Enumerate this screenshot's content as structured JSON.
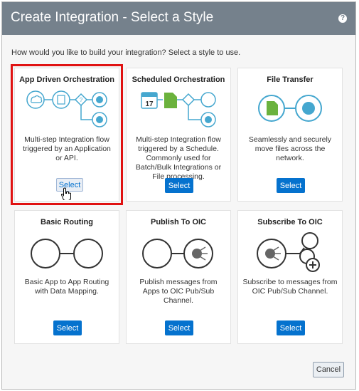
{
  "dialog": {
    "title": "Create Integration - Select a Style",
    "help_label": "?",
    "prompt": "How would you like to build your integration? Select a style to use."
  },
  "cards": [
    {
      "name": "App Driven Orchestration",
      "desc": "Multi-step Integration flow triggered by an Application or API.",
      "button": "Select",
      "selected": true
    },
    {
      "name": "Scheduled Orchestration",
      "desc": "Multi-step Integration flow triggered by a Schedule. Commonly used for Batch/Bulk Integrations or File processing.",
      "button": "Select",
      "calendar_day": "17"
    },
    {
      "name": "File Transfer",
      "desc": "Seamlessly and securely move files across the network.",
      "button": "Select"
    },
    {
      "name": "Basic Routing",
      "desc": "Basic App to App Routing with Data Mapping.",
      "button": "Select"
    },
    {
      "name": "Publish To OIC",
      "desc": "Publish messages from Apps to OIC Pub/Sub Channel.",
      "button": "Select"
    },
    {
      "name": "Subscribe To OIC",
      "desc": "Subscribe to messages from OIC Pub/Sub Channel.",
      "button": "Select"
    }
  ],
  "footer": {
    "cancel_label": "Cancel"
  },
  "colors": {
    "header": "#75818c",
    "accent": "#0572ce",
    "selected_outline": "#e01212",
    "icon_stroke": "#45a7cf",
    "icon_green": "#6bb23d"
  }
}
